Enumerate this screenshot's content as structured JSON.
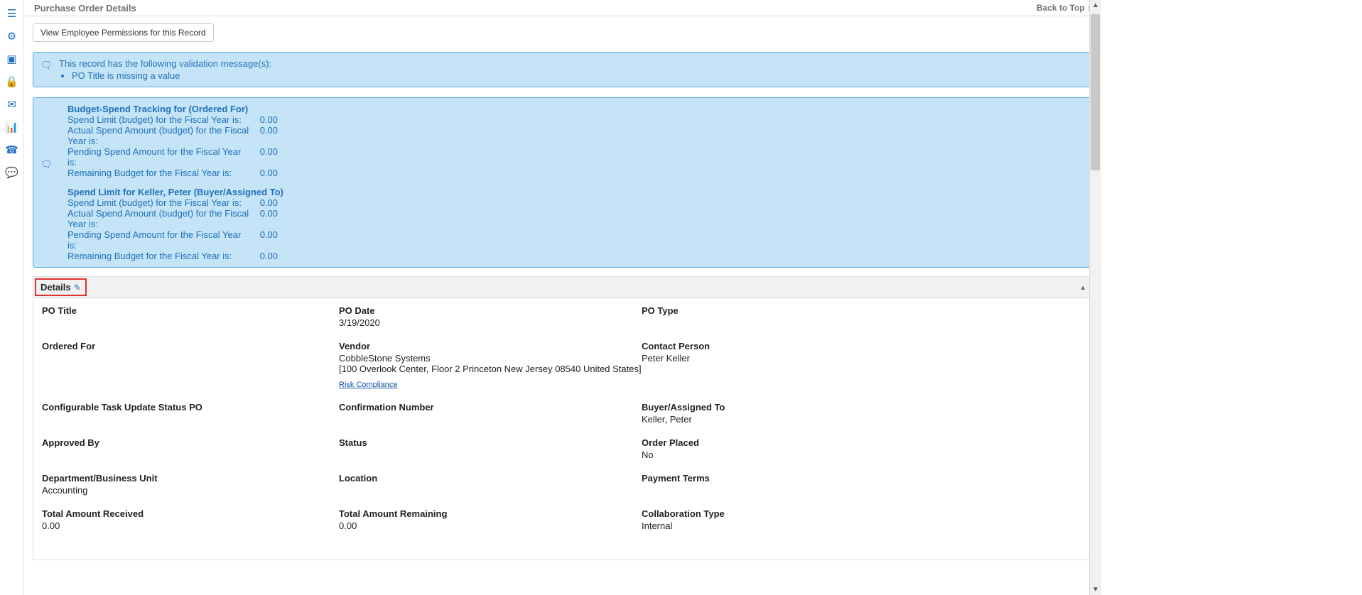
{
  "sidebar": {
    "icons": [
      "menu-icon",
      "gear-icon",
      "document-icon",
      "lock-icon",
      "mail-icon",
      "chart-icon",
      "handset-icon",
      "chat-icon"
    ]
  },
  "header": {
    "title": "Purchase Order Details",
    "back_to_top": "Back to Top ↑"
  },
  "permissions_btn": "View Employee Permissions for this Record",
  "validation": {
    "head": "This record has the following validation message(s):",
    "items": [
      "PO Title is missing a value"
    ]
  },
  "budget_sections": [
    {
      "title": "Budget-Spend Tracking for (Ordered For)",
      "rows": [
        {
          "label": "Spend Limit (budget) for the Fiscal Year is:",
          "value": "0.00"
        },
        {
          "label": "Actual Spend Amount (budget) for the Fiscal Year is:",
          "value": "0.00"
        },
        {
          "label": "Pending Spend Amount for the Fiscal Year is:",
          "value": "0.00"
        },
        {
          "label": "Remaining Budget for the Fiscal Year is:",
          "value": "0.00"
        }
      ]
    },
    {
      "title": "Spend Limit for Keller, Peter (Buyer/Assigned To)",
      "rows": [
        {
          "label": "Spend Limit (budget) for the Fiscal Year is:",
          "value": "0.00"
        },
        {
          "label": "Actual Spend Amount (budget) for the Fiscal Year is:",
          "value": "0.00"
        },
        {
          "label": "Pending Spend Amount for the Fiscal Year is:",
          "value": "0.00"
        },
        {
          "label": "Remaining Budget for the Fiscal Year is:",
          "value": "0.00"
        }
      ]
    }
  ],
  "details": {
    "header_label": "Details",
    "po_title": {
      "label": "PO Title",
      "value": ""
    },
    "po_date": {
      "label": "PO Date",
      "value": "3/19/2020"
    },
    "po_type": {
      "label": "PO Type",
      "value": ""
    },
    "ordered_for": {
      "label": "Ordered For",
      "value": ""
    },
    "vendor": {
      "label": "Vendor",
      "name": "CobbleStone Systems",
      "addr": "[100 Overlook Center, Floor 2 Princeton New Jersey 08540 United States]",
      "link": "Risk Compliance"
    },
    "contact": {
      "label": "Contact Person",
      "value": "Peter Keller"
    },
    "task_status": {
      "label": "Configurable Task Update Status PO",
      "value": ""
    },
    "confirmation": {
      "label": "Confirmation Number",
      "value": ""
    },
    "buyer": {
      "label": "Buyer/Assigned To",
      "value": "Keller, Peter"
    },
    "approved": {
      "label": "Approved By",
      "value": ""
    },
    "status": {
      "label": "Status",
      "value": ""
    },
    "order_placed": {
      "label": "Order Placed",
      "value": "No"
    },
    "dept": {
      "label": "Department/Business Unit",
      "value": "Accounting"
    },
    "location": {
      "label": "Location",
      "value": ""
    },
    "payment_terms": {
      "label": "Payment Terms",
      "value": ""
    },
    "total_received": {
      "label": "Total Amount Received",
      "value": "0.00"
    },
    "total_remaining": {
      "label": "Total Amount Remaining",
      "value": "0.00"
    },
    "collab": {
      "label": "Collaboration Type",
      "value": "Internal"
    }
  }
}
